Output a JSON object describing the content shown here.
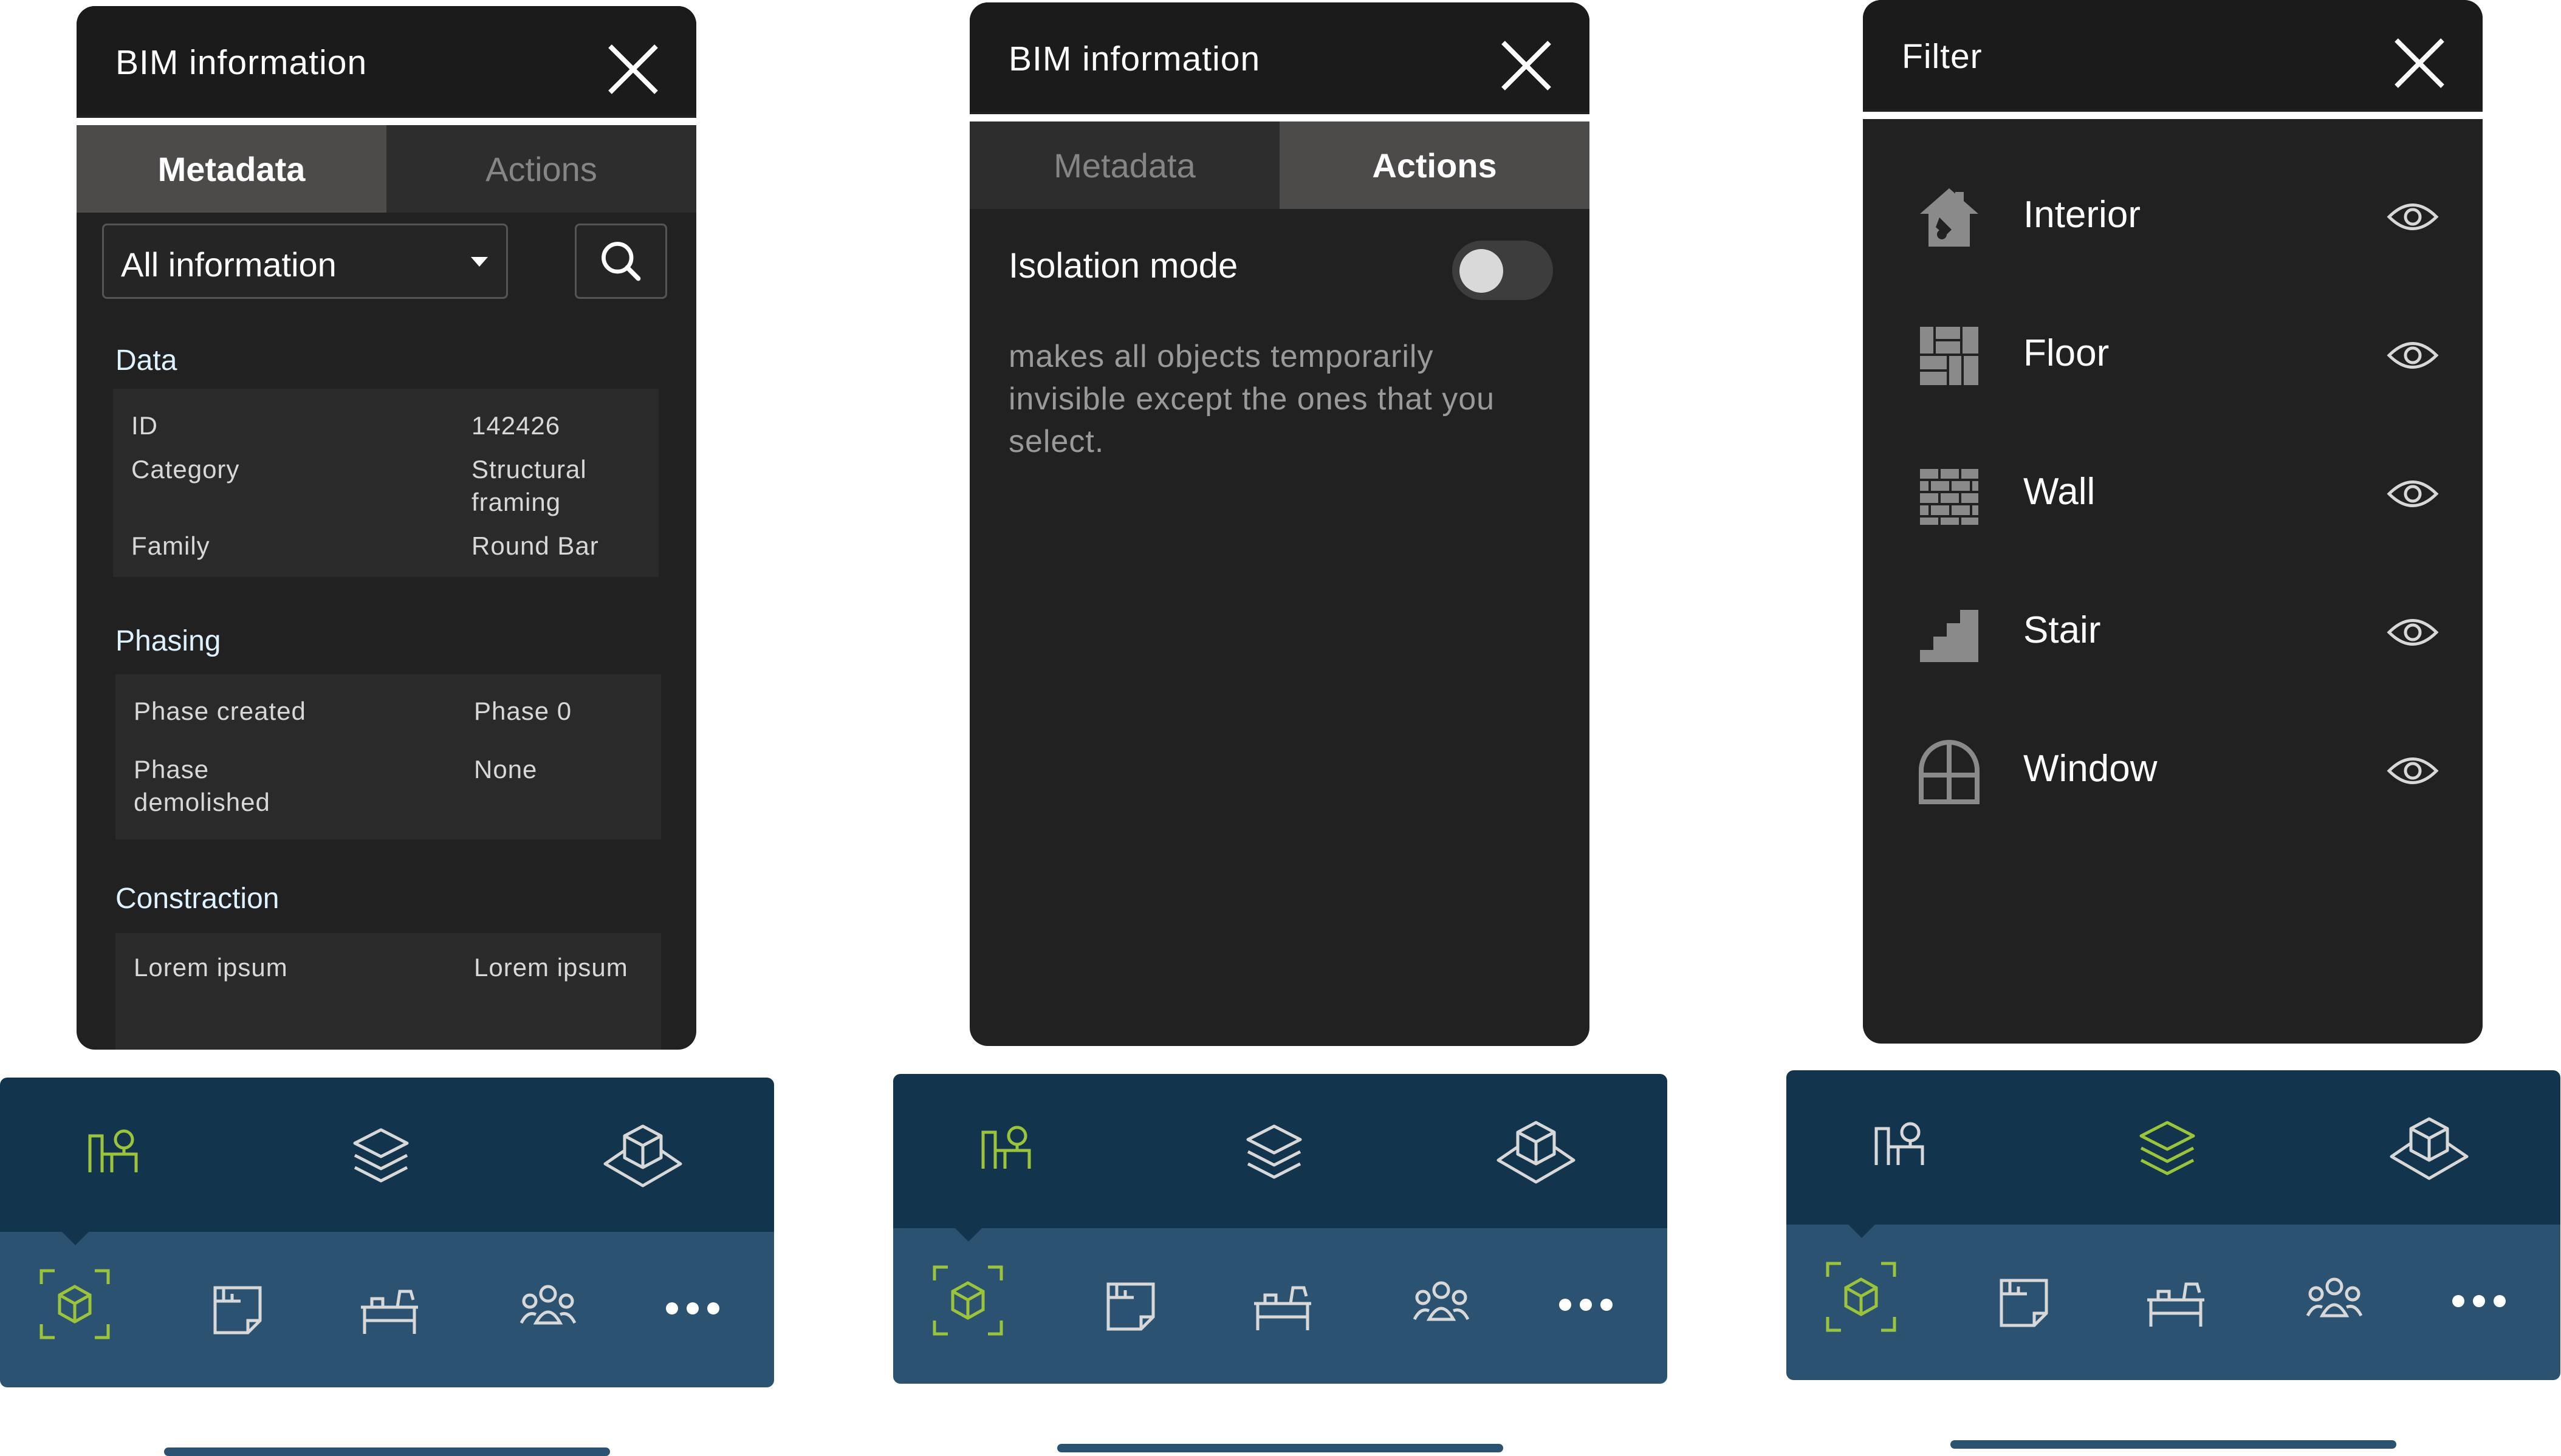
{
  "colors": {
    "panel_bg": "#212121",
    "header_bg": "#1b1b1b",
    "nav_top": "#13344d",
    "nav_bottom": "#2b5271",
    "accent_green": "#9bc43a",
    "icon_light": "#d8d8d8"
  },
  "screen1": {
    "header": {
      "title": "BIM information"
    },
    "tabs": {
      "metadata": "Metadata",
      "actions": "Actions",
      "active": "Metadata"
    },
    "selector": {
      "value": "All information"
    },
    "sections": {
      "data": {
        "title": "Data",
        "rows": [
          {
            "key": "ID",
            "value": "142426"
          },
          {
            "key": "Category",
            "value": "Structural framing"
          },
          {
            "key": "Family",
            "value": "Round Bar"
          }
        ]
      },
      "phasing": {
        "title": "Phasing",
        "rows": [
          {
            "key": "Phase created",
            "value": "Phase 0"
          },
          {
            "key": "Phase demolished",
            "value": "None"
          }
        ]
      },
      "construction": {
        "title": "Constraction",
        "rows": [
          {
            "key": "Lorem ipsum",
            "value": "Lorem ipsum"
          }
        ]
      }
    }
  },
  "screen2": {
    "header": {
      "title": "BIM information"
    },
    "tabs": {
      "metadata": "Metadata",
      "actions": "Actions",
      "active": "Actions"
    },
    "isolation": {
      "label": "Isolation mode",
      "enabled": false,
      "description": "makes all objects temporarily invisible except the ones that you select."
    }
  },
  "screen3": {
    "header": {
      "title": "Filter"
    },
    "filters": [
      {
        "label": "Interior",
        "icon": "house-paint-icon",
        "visible": true
      },
      {
        "label": "Floor",
        "icon": "floor-tiles-icon",
        "visible": true
      },
      {
        "label": "Wall",
        "icon": "brick-wall-icon",
        "visible": true
      },
      {
        "label": "Stair",
        "icon": "stair-icon",
        "visible": true
      },
      {
        "label": "Window",
        "icon": "window-icon",
        "visible": true
      }
    ]
  },
  "nav": {
    "top_items": [
      "site-plan-icon",
      "layers-icon",
      "3d-model-icon"
    ],
    "bottom_items": [
      "3d-view-icon",
      "blueprint-icon",
      "desk-icon",
      "team-icon",
      "more-icon"
    ],
    "screen1_active_top": "site-plan-icon",
    "screen2_active_top": "site-plan-icon",
    "screen3_active_top": "layers-icon",
    "active_bottom": "3d-view-icon"
  }
}
